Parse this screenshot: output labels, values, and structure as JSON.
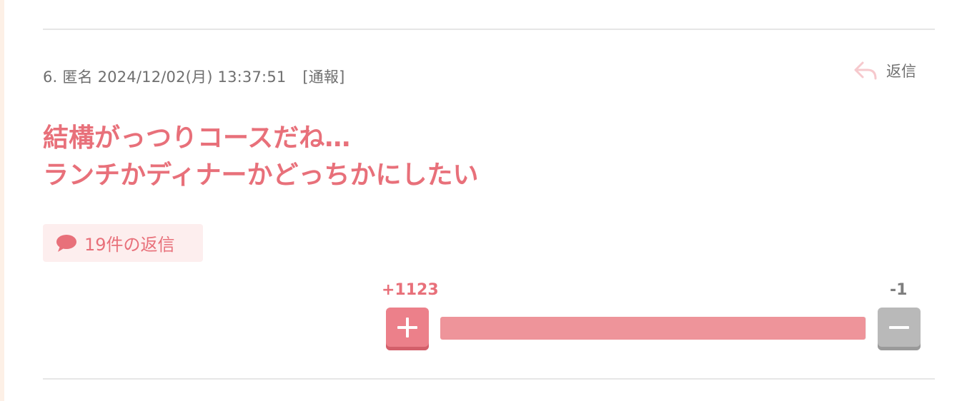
{
  "comment": {
    "number": "6.",
    "author": "匿名",
    "datetime": "2024/12/02(月) 13:37:51",
    "report_label": "[通報]",
    "reply_label": "返信",
    "body_lines": [
      "結構がっつりコースだね…",
      "ランチかディナーかどっちかにしたい"
    ],
    "replies_label": "19件の返信"
  },
  "votes": {
    "plus_label": "+1123",
    "minus_label": "-1",
    "plus": 1123,
    "minus": 1
  },
  "colors": {
    "accent": "#e8707a",
    "bar_fill": "#ee949a",
    "badge_bg": "#fdeeee",
    "minus_gray": "#b9b9b9"
  },
  "icons": {
    "reply": "reply-arrow-icon",
    "replies": "speech-bubble-icon",
    "plus": "plus-icon",
    "minus": "minus-icon"
  }
}
